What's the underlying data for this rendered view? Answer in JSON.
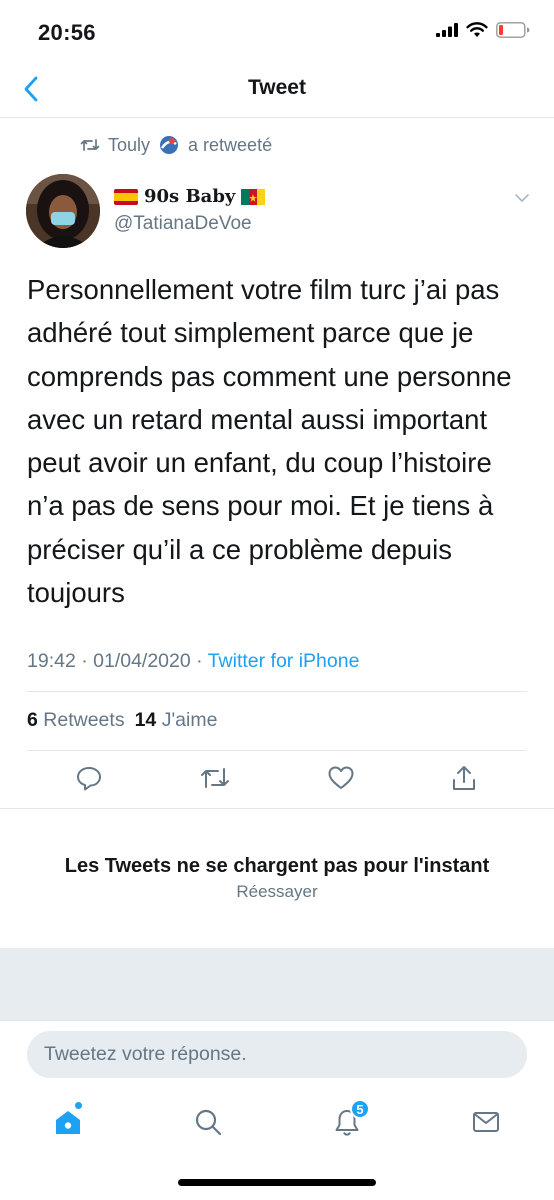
{
  "status_bar": {
    "time": "20:56"
  },
  "nav": {
    "title": "Tweet"
  },
  "retweet": {
    "user": "Touly",
    "label": "a retweeté"
  },
  "author": {
    "name": "90s Baby",
    "handle": "@TatianaDeVoe"
  },
  "tweet": {
    "text": "Personnellement votre film turc j’ai pas adhéré tout simplement parce que je comprends pas comment une personne avec un retard mental aussi important peut avoir un enfant, du coup l’histoire n’a pas de sens pour moi. Et je tiens à préciser qu’il a ce problème depuis toujours",
    "time": "19:42 · 01/04/2020 · ",
    "source": "Twitter for iPhone"
  },
  "stats": {
    "retweets_count": "6",
    "retweets_label": "Retweets",
    "likes_count": "14",
    "likes_label": "J'aime"
  },
  "actions": {
    "reply": "reply-icon",
    "retweet": "retweet-icon",
    "like": "heart-icon",
    "share": "share-icon"
  },
  "replies": {
    "error_title": "Les Tweets ne se chargent pas pour l'instant",
    "retry_label": "Réessayer"
  },
  "composer": {
    "placeholder": "Tweetez votre réponse."
  },
  "tabs": {
    "notifications_badge": "5"
  },
  "colors": {
    "accent": "#1da1f2",
    "secondary_text": "#657786",
    "divider": "#e1e8ed"
  }
}
